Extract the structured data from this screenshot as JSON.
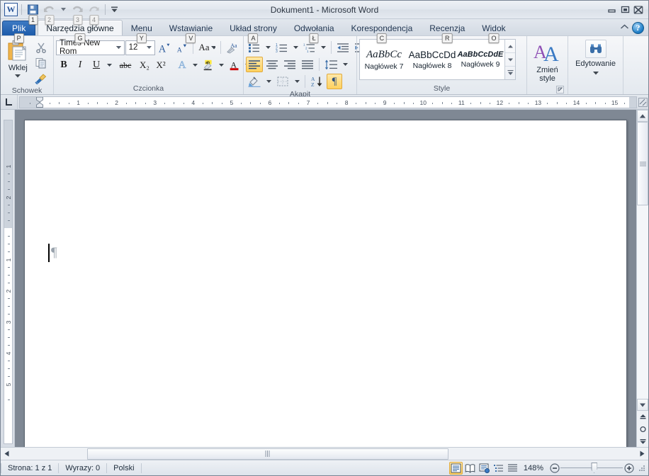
{
  "window": {
    "title": "Dokument1  -  Microsoft Word",
    "minimize_label": "Minimalizuj",
    "restore_label": "Przywróć",
    "close_label": "Zamknij"
  },
  "quick_access": {
    "items": [
      {
        "name": "save",
        "icon": "save-icon",
        "keytip": "1",
        "enabled": true
      },
      {
        "name": "undo",
        "icon": "undo-icon",
        "keytip": "2",
        "enabled": false
      },
      {
        "name": "redo",
        "icon": "redo-icon",
        "keytip": "3",
        "enabled": false
      },
      {
        "name": "repeat",
        "icon": "repeat-icon",
        "keytip": "4",
        "enabled": false
      }
    ],
    "customize_label": "Dostosuj pasek narzędzi Szybki dostęp"
  },
  "tabs": [
    {
      "label": "Plik",
      "keytip": "P",
      "type": "file"
    },
    {
      "label": "Narzędzia główne",
      "keytip": "G",
      "active": true
    },
    {
      "label": "Menu",
      "keytip": "Y"
    },
    {
      "label": "Wstawianie",
      "keytip": "V"
    },
    {
      "label": "Układ strony",
      "keytip": "A"
    },
    {
      "label": "Odwołania",
      "keytip": "Ł"
    },
    {
      "label": "Korespondencja",
      "keytip": "C"
    },
    {
      "label": "Recenzja",
      "keytip": "R"
    },
    {
      "label": "Widok",
      "keytip": "O"
    }
  ],
  "ribbon_right": {
    "collapse_icon": "chevron-up-icon",
    "help_icon": "help-icon",
    "help_label": "?"
  },
  "groups": {
    "clipboard": {
      "label": "Schowek",
      "paste_label": "Wklej",
      "paste_icon": "paste-icon",
      "cut_icon": "scissors-icon",
      "copy_icon": "copy-icon",
      "format_painter_icon": "format-painter-icon",
      "launcher_icon": "dialog-launcher-icon"
    },
    "font": {
      "label": "Czcionka",
      "font_name": "Times New Rom",
      "font_size": "12",
      "grow_font": "A",
      "shrink_font": "A",
      "change_case": "Aa",
      "clear_formatting_icon": "clear-formatting-icon",
      "bold": "B",
      "italic": "I",
      "underline": "U",
      "strikethrough": "abc",
      "subscript": "X₂",
      "superscript": "X²",
      "text_effects": "A",
      "highlight_icon": "highlight-icon",
      "font_color": "A",
      "launcher_icon": "dialog-launcher-icon"
    },
    "paragraph": {
      "label": "Akapit",
      "bullets_icon": "bullets-icon",
      "numbering_icon": "numbering-icon",
      "multilevel_icon": "multilevel-list-icon",
      "decrease_indent_icon": "decrease-indent-icon",
      "increase_indent_icon": "increase-indent-icon",
      "align_left_icon": "align-left-icon",
      "align_center_icon": "align-center-icon",
      "align_right_icon": "align-right-icon",
      "justify_icon": "justify-icon",
      "line_spacing_icon": "line-spacing-icon",
      "shading_icon": "shading-icon",
      "borders_icon": "borders-icon",
      "sort_icon": "sort-icon",
      "show_marks_icon": "pilcrow-icon",
      "show_marks_glyph": "¶",
      "align_left_active": true,
      "show_marks_active": true,
      "launcher_icon": "dialog-launcher-icon"
    },
    "styles": {
      "label": "Style",
      "gallery": [
        {
          "sample": "AaBbCc",
          "name": "Nagłówek 7"
        },
        {
          "sample": "AaBbCcDd",
          "name": "Nagłówek 8"
        },
        {
          "sample": "AaBbCcDdE",
          "name": "Nagłówek 9"
        }
      ],
      "scroll_up_icon": "caret-up-icon",
      "scroll_down_icon": "caret-down-icon",
      "more_icon": "gallery-more-icon",
      "launcher_icon": "dialog-launcher-icon"
    },
    "change_styles": {
      "label": "Zmień style",
      "icon": "change-styles-icon",
      "dropdown_icon": "chevron-down-icon"
    },
    "editing": {
      "label": "Edytowanie",
      "icon": "binoculars-icon",
      "dropdown_icon": "chevron-down-icon"
    }
  },
  "ruler": {
    "tab_selector_icon": "tab-left-icon",
    "horizontal_labels": [
      "1",
      "2",
      "3",
      "4",
      "5",
      "6",
      "7",
      "8",
      "9",
      "10",
      "11",
      "12",
      "13",
      "14",
      "15"
    ],
    "vertical_margin_labels": [
      "2",
      "1"
    ],
    "vertical_labels": [
      "1",
      "2",
      "3",
      "4",
      "5"
    ],
    "ruler_toggle_icon": "ruler-toggle-icon"
  },
  "document": {
    "caret_visible": true,
    "paragraph_mark": "¶",
    "content": ""
  },
  "scrollbars": {
    "up_arrow": "▲",
    "down_arrow": "▼",
    "left_arrow": "◀",
    "right_arrow": "▶",
    "prev_page_icon": "previous-page-icon",
    "select_browse_icon": "select-browse-object-icon",
    "next_page_icon": "next-page-icon"
  },
  "status_bar": {
    "page": "Strona: 1 z 1",
    "words": "Wyrazy: 0",
    "language": "Polski",
    "views": [
      {
        "name": "print-layout",
        "icon": "print-layout-icon",
        "active": true
      },
      {
        "name": "full-screen-reading",
        "icon": "full-screen-reading-icon",
        "active": false
      },
      {
        "name": "web-layout",
        "icon": "web-layout-icon",
        "active": false
      },
      {
        "name": "outline",
        "icon": "outline-icon",
        "active": false
      },
      {
        "name": "draft",
        "icon": "draft-icon",
        "active": false
      }
    ],
    "zoom": "148%",
    "zoom_out_label": "−",
    "zoom_in_label": "+",
    "resize_grip_icon": "resize-grip-icon"
  }
}
